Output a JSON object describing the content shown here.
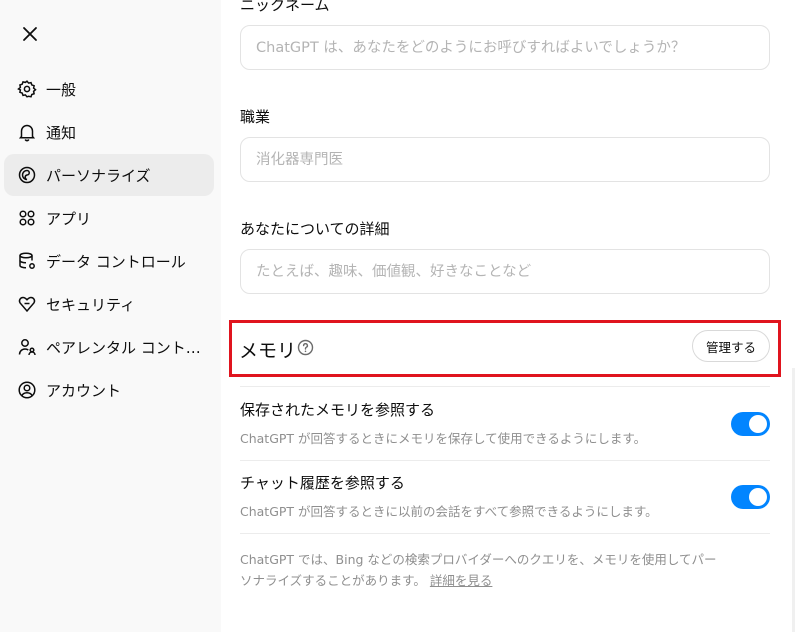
{
  "sidebar": {
    "close_icon": "close-icon",
    "items": [
      {
        "label": "一般",
        "icon": "gear-icon",
        "active": false
      },
      {
        "label": "通知",
        "icon": "bell-icon",
        "active": false
      },
      {
        "label": "パーソナライズ",
        "icon": "personalize-icon",
        "active": true
      },
      {
        "label": "アプリ",
        "icon": "apps-grid-icon",
        "active": false
      },
      {
        "label": "データ コントロール",
        "icon": "database-gear-icon",
        "active": false
      },
      {
        "label": "セキュリティ",
        "icon": "shield-icon",
        "active": false
      },
      {
        "label": "ペアレンタル コントロール",
        "icon": "parental-icon",
        "active": false
      },
      {
        "label": "アカウント",
        "icon": "account-icon",
        "active": false
      }
    ]
  },
  "main": {
    "nickname": {
      "label": "ニックネーム",
      "value": "",
      "placeholder": "ChatGPT は、あなたをどのようにお呼びすればよいでしょうか？"
    },
    "occupation": {
      "label": "職業",
      "value": "",
      "placeholder": "消化器専門医"
    },
    "about": {
      "label": "あなたについての詳細",
      "value": "",
      "placeholder": "たとえば、趣味、価値観、好きなことなど"
    },
    "memory": {
      "title": "メモリ",
      "help_icon": "help-circle-icon",
      "manage_label": "管理する",
      "highlight_color": "#e0141e",
      "saved": {
        "title": "保存されたメモリを参照する",
        "desc": "ChatGPT が回答するときにメモリを保存して使用できるようにします。",
        "enabled": true
      },
      "history": {
        "title": "チャット履歴を参照する",
        "desc": "ChatGPT が回答するときに以前の会話をすべて参照できるようにします。",
        "enabled": true
      },
      "footnote": "ChatGPT では、Bing などの検索プロバイダーへのクエリを、メモリを使用してパーソナライズすることがあります。",
      "learn_more": "詳細を見る"
    }
  },
  "colors": {
    "toggle_on": "#0285ff",
    "active_nav_bg": "#ececec",
    "sidebar_bg": "#f9f9f9"
  }
}
